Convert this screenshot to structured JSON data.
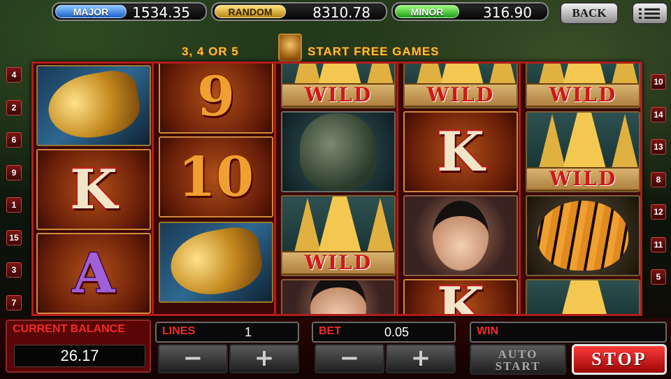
{
  "jackpots": [
    {
      "label": "MAJOR",
      "value": "1534.35",
      "color": "#1d62c8"
    },
    {
      "label": "RANDOM",
      "value": "8310.78",
      "color": "#b58612"
    },
    {
      "label": "MINOR",
      "value": "316.90",
      "color": "#1f9b1a"
    }
  ],
  "top_buttons": {
    "back_label": "BACK",
    "menu_icon": "hamburger-menu-icon"
  },
  "banner": {
    "left_text": "3, 4 OR 5",
    "right_text": "START FREE GAMES"
  },
  "paylines_left": [
    "4",
    "2",
    "6",
    "9",
    "1",
    "15",
    "3",
    "7"
  ],
  "paylines_right": [
    "10",
    "14",
    "13",
    "8",
    "12",
    "11",
    "5"
  ],
  "reels": [
    [
      "dragon",
      "K",
      "A"
    ],
    [
      "9",
      "10",
      "dragon"
    ],
    [
      "wild-temple",
      "lion",
      "wild-temple",
      "lady"
    ],
    [
      "wild-temple",
      "K",
      "lady",
      "K"
    ],
    [
      "wild-temple",
      "wild-temple",
      "tiger",
      "temple"
    ]
  ],
  "symbol_text": {
    "wild": "WILD",
    "k": "K",
    "a": "A",
    "nine": "9",
    "ten": "10"
  },
  "controls": {
    "balance_label": "CURRENT BALANCE",
    "balance_value": "26.17",
    "lines_label": "LINES",
    "lines_value": "1",
    "bet_label": "BET",
    "bet_value": "0.05",
    "win_label": "WIN",
    "win_value": "",
    "minus": "−",
    "plus": "+",
    "auto_start_line1": "AUTO",
    "auto_start_line2": "START",
    "stop_label": "STOP"
  },
  "colors": {
    "accent_red": "#b41b1b",
    "label_red": "#f02a2a",
    "banner_gold": "#f5c23a"
  }
}
